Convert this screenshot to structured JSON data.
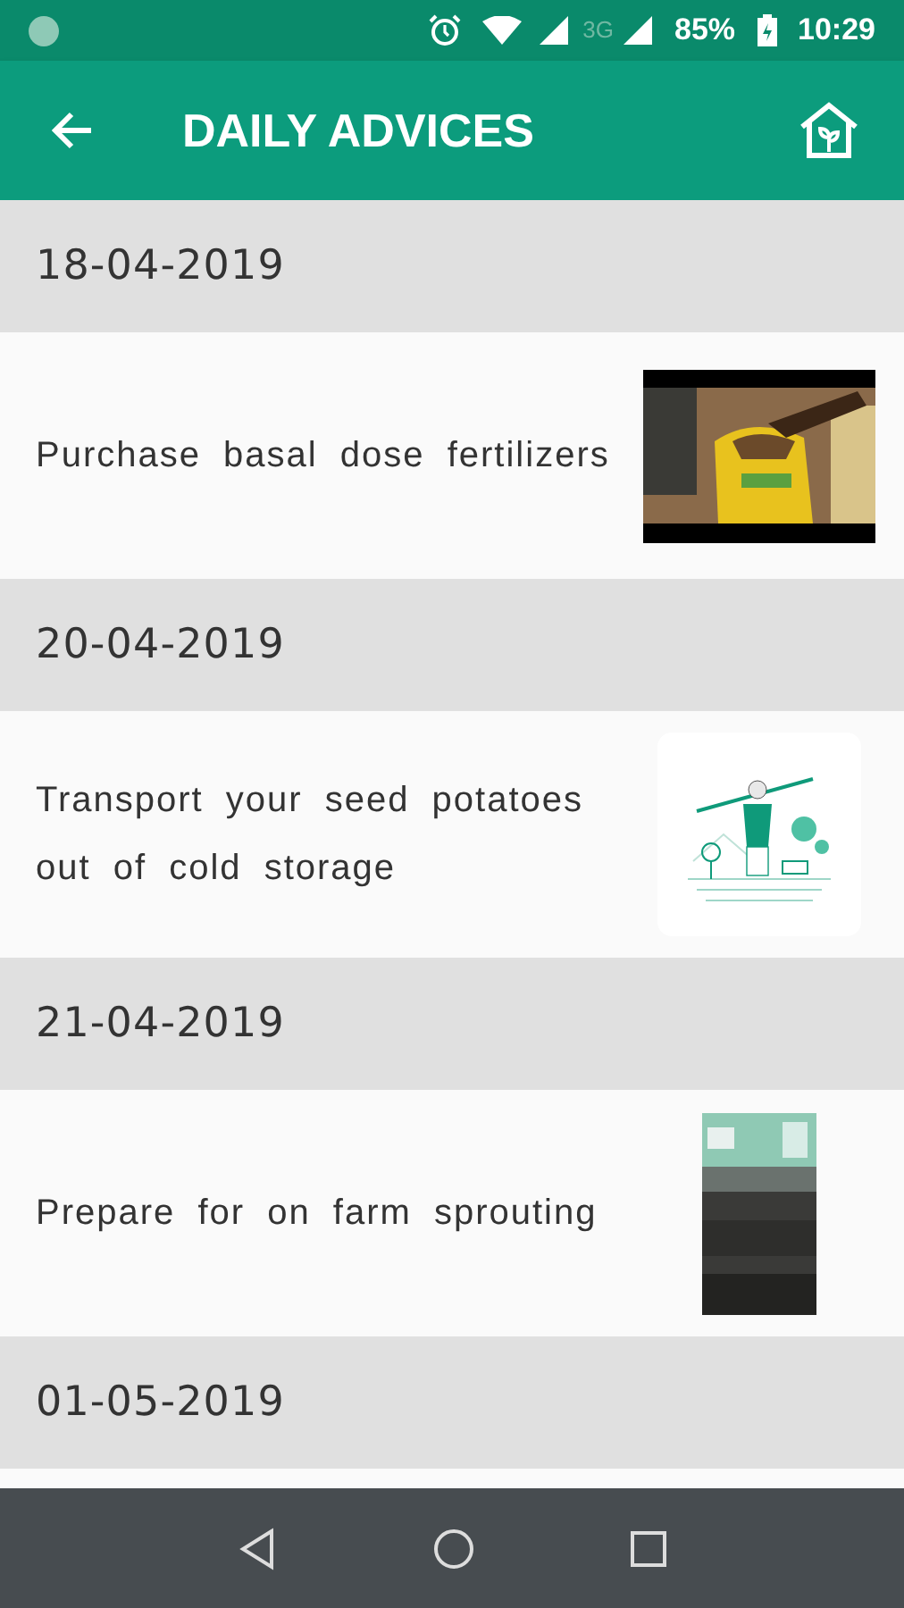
{
  "status_bar": {
    "battery": "85%",
    "network": "3G",
    "time": "10:29"
  },
  "toolbar": {
    "title": "DAILY ADVICES"
  },
  "advices": [
    {
      "date": "18-04-2019",
      "text": "Purchase basal dose fertilizers",
      "thumbnail": {
        "kind": "fertilizer-photo"
      }
    },
    {
      "date": "20-04-2019",
      "text": "Transport your seed potatoes out of cold storage",
      "thumbnail": {
        "kind": "illustration"
      }
    },
    {
      "date": "21-04-2019",
      "text": "Prepare for on farm sprouting",
      "thumbnail": {
        "kind": "storage-photo"
      }
    },
    {
      "date": "01-05-2019"
    }
  ]
}
